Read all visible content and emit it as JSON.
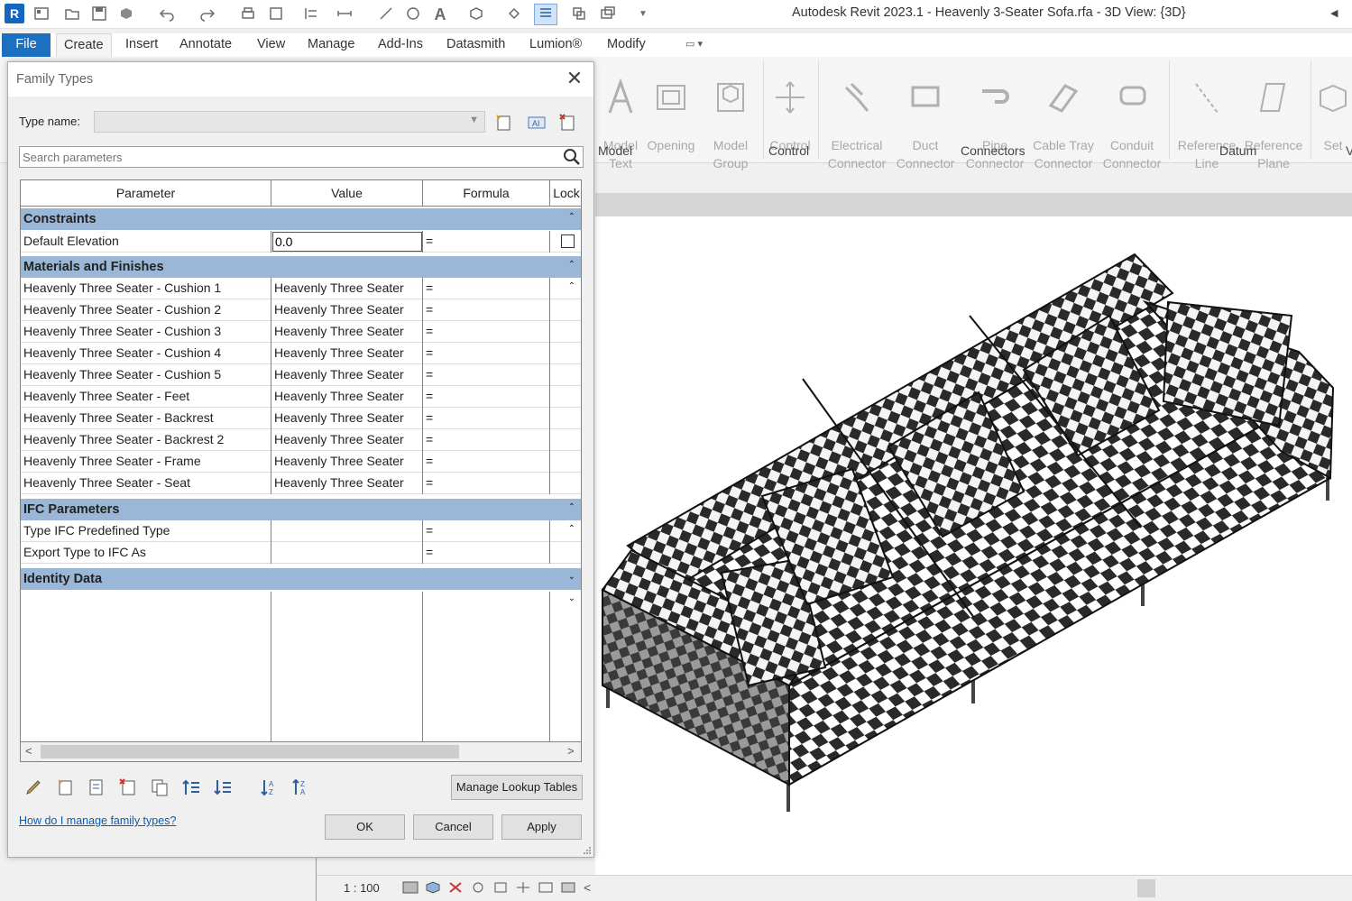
{
  "app": {
    "logo_letter": "R",
    "window_title": "Autodesk Revit 2023.1 - Heavenly 3-Seater Sofa.rfa - 3D View: {3D}"
  },
  "qat_icons": [
    "home-icon",
    "open-icon",
    "save-icon",
    "sync-icon",
    "undo-icon",
    "redo-icon",
    "print-icon",
    "measure-icon",
    "text-icon",
    "view-icon",
    "switch-windows-icon",
    "dropdown-icon"
  ],
  "ribbon": {
    "tabs": [
      {
        "label": "File"
      },
      {
        "label": "Create"
      },
      {
        "label": "Insert"
      },
      {
        "label": "Annotate"
      },
      {
        "label": "View"
      },
      {
        "label": "Manage"
      },
      {
        "label": "Add-Ins"
      },
      {
        "label": "Datasmith"
      },
      {
        "label": "Lumion®"
      },
      {
        "label": "Modify"
      }
    ],
    "active_tab": "Create",
    "buttons": [
      {
        "label": "Model\nText"
      },
      {
        "label": "Opening"
      },
      {
        "label": "Model\nGroup"
      },
      {
        "label": "Control"
      },
      {
        "label": "Electrical\nConnector"
      },
      {
        "label": "Duct\nConnector"
      },
      {
        "label": "Pipe\nConnector"
      },
      {
        "label": "Cable Tray\nConnector"
      },
      {
        "label": "Conduit\nConnector"
      },
      {
        "label": "Reference\nLine"
      },
      {
        "label": "Reference\nPlane"
      },
      {
        "label": "Set"
      }
    ],
    "groups": {
      "model": "Model",
      "control": "Control",
      "connectors": "Connectors",
      "datum": "Datum",
      "work_plane_partial": "V"
    }
  },
  "dialog": {
    "title": "Family Types",
    "type_name_label": "Type name:",
    "type_name_value": "",
    "search_placeholder": "Search parameters",
    "columns": {
      "parameter": "Parameter",
      "value": "Value",
      "formula": "Formula",
      "lock": "Lock"
    },
    "groups": {
      "constraints": "Constraints",
      "materials": "Materials and Finishes",
      "ifc": "IFC Parameters",
      "identity": "Identity Data"
    },
    "constraints_rows": [
      {
        "param": "Default Elevation",
        "value": "0.0",
        "formula": "="
      }
    ],
    "materials_rows": [
      {
        "param": "Heavenly Three Seater - Cushion 1",
        "value": "Heavenly Three Seater",
        "formula": "="
      },
      {
        "param": "Heavenly Three Seater - Cushion 2",
        "value": "Heavenly Three Seater",
        "formula": "="
      },
      {
        "param": "Heavenly Three Seater - Cushion 3",
        "value": "Heavenly Three Seater",
        "formula": "="
      },
      {
        "param": "Heavenly Three Seater - Cushion 4",
        "value": "Heavenly Three Seater",
        "formula": "="
      },
      {
        "param": "Heavenly Three Seater - Cushion 5",
        "value": "Heavenly Three Seater",
        "formula": "="
      },
      {
        "param": "Heavenly Three Seater - Feet",
        "value": "Heavenly Three Seater",
        "formula": "="
      },
      {
        "param": "Heavenly Three Seater - Backrest",
        "value": "Heavenly Three Seater",
        "formula": "="
      },
      {
        "param": "Heavenly Three Seater - Backrest 2",
        "value": "Heavenly Three Seater",
        "formula": "="
      },
      {
        "param": "Heavenly Three Seater -  Frame",
        "value": "Heavenly Three Seater",
        "formula": "="
      },
      {
        "param": "Heavenly Three Seater - Seat",
        "value": "Heavenly Three Seater",
        "formula": "="
      }
    ],
    "ifc_rows": [
      {
        "param": "Type IFC Predefined Type",
        "value": "",
        "formula": "="
      },
      {
        "param": "Export Type to IFC As",
        "value": "",
        "formula": "="
      }
    ],
    "manage_lookup_label": "Manage Lookup Tables",
    "help_link": "How do I manage family types?",
    "ok_label": "OK",
    "cancel_label": "Cancel",
    "apply_label": "Apply"
  },
  "statusbar": {
    "scale": "1 : 100"
  },
  "colors": {
    "file_tab": "#1d6fc0",
    "group_header": "#9ab7d7",
    "link": "#0b5cad"
  }
}
